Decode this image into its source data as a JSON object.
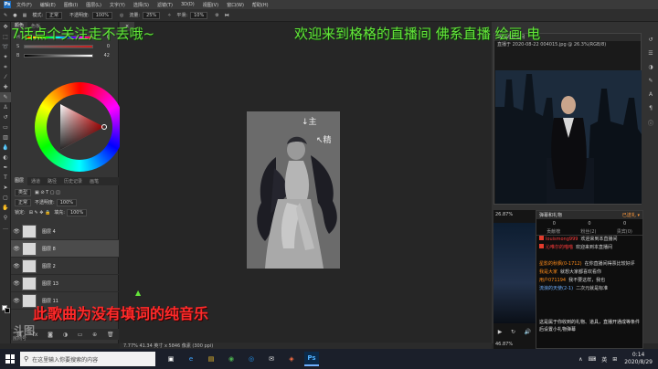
{
  "menubar": {
    "logo": "Ps",
    "items": [
      "文件(F)",
      "编辑(E)",
      "图像(I)",
      "图层(L)",
      "文字(Y)",
      "选择(S)",
      "滤镜(T)",
      "3D(D)",
      "视图(V)",
      "窗口(W)",
      "帮助(H)"
    ]
  },
  "optionsbar": {
    "mode_label": "模式:",
    "mode_value": "正常",
    "opacity_label": "不透明度:",
    "opacity_value": "100%",
    "flow_label": "流量:",
    "flow_value": "25%",
    "smoothing_label": "平滑:",
    "smoothing_value": "10%"
  },
  "overlay": {
    "left_caption": "7话点个关注走不丢哦~",
    "right_caption": "欢迎来到格格的直播间   佛系直播 绘画 电",
    "lyric_caption": "此歌曲为没有填词的纯音乐",
    "watermark_main": "斗图",
    "watermark_sub": "房间号",
    "canvas_mark": "▲",
    "caption_color": "#64e43a",
    "lyric_color": "#ff2a2a"
  },
  "color_panel": {
    "tabs": [
      "颜色",
      "色板"
    ],
    "sliders": [
      {
        "label": "H",
        "value": "0"
      },
      {
        "label": "S",
        "value": "0"
      },
      {
        "label": "B",
        "value": "42"
      }
    ]
  },
  "layers_panel": {
    "tabs": [
      "图层",
      "通道",
      "路径",
      "历史记录",
      "画笔"
    ],
    "kind_label": "类型",
    "blend_mode": "正常",
    "opacity_label": "不透明度:",
    "opacity_value": "100%",
    "lock_label": "锁定:",
    "fill_label": "填充:",
    "fill_value": "100%",
    "layers": [
      {
        "name": "图层 4",
        "selected": false
      },
      {
        "name": "图层 8",
        "selected": true
      },
      {
        "name": "图层 2",
        "selected": false
      },
      {
        "name": "图层 13",
        "selected": false
      },
      {
        "name": "图层 11",
        "selected": false
      }
    ]
  },
  "document": {
    "tab": "×",
    "status": "7.77%    41.34 英寸 x 5846 像素 (300 ppi)"
  },
  "stream_panel": {
    "title": "格格的直播间",
    "date": "直播于 2020-08-22 004015.jpg @ 26.3%(RGB/8)",
    "player_zoom": "26.87%",
    "player_bottom": "46.87%"
  },
  "chat": {
    "header": "弹幕和礼物",
    "gifts_label": "已送礼 ▾",
    "stats": [
      "0",
      "0",
      "0"
    ],
    "cols": [
      "贡献榜",
      "粉丝(2)",
      "贵宾(0)"
    ],
    "messages": [
      {
        "nick": "louismong999",
        "text": "欢迎来到本直播间",
        "cls": "nick-red",
        "badge": true
      },
      {
        "nick": "沁唯尔的喵喵",
        "text": "欢迎来到本直播间",
        "cls": "nick-red",
        "badge": true
      },
      {
        "nick": "",
        "text": "",
        "cls": "",
        "badge": false
      },
      {
        "nick": "星影的秋枫(0-1712)",
        "text": "在你直播间得票比较好评",
        "cls": "nick-orange",
        "badge": false
      },
      {
        "nick": "我是大家",
        "text": "就想大家都喜欢看你",
        "cls": "nick-orange",
        "badge": false
      },
      {
        "nick": "用户071194",
        "text": "我不要这样，我也",
        "cls": "nick-orange",
        "badge": false
      },
      {
        "nick": "流浪的天使(2-1)",
        "text": "二次元就是标准",
        "cls": "nick-blue",
        "badge": false
      }
    ],
    "notice": "这是属于你收到的礼物、道具，直播开通成等条件后设置小礼物弹幕"
  },
  "taskbar": {
    "search_placeholder": "在这里输入你要搜索的内容",
    "apps": [
      "e",
      "▣",
      "◉",
      "◎",
      "✉",
      "◈",
      "▤"
    ],
    "ps_label": "Ps",
    "tray_items": [
      "∧",
      "⌨",
      "英",
      "⊞"
    ],
    "time": "0:14",
    "date": "2020/8/29"
  },
  "colors": {
    "accent_ps": "#1f6fc0",
    "chat_red": "#ff3b3b",
    "chat_orange": "#ff8c1a"
  }
}
